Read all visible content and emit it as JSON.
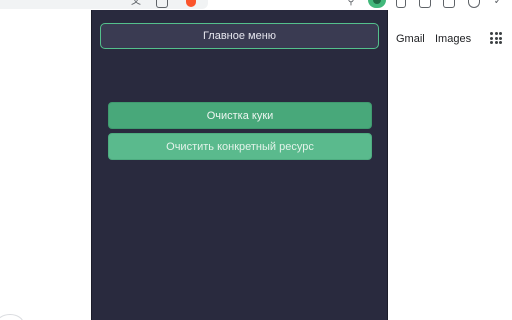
{
  "browser": {
    "toolbar_icons": [
      "translate-icon",
      "cast-icon",
      "brave-shield-icon",
      "extension-a-icon",
      "active-extension-icon",
      "puzzle-icon",
      "download-icon",
      "sidepanel-icon",
      "profile-icon",
      "bookmark-plus-icon"
    ]
  },
  "google": {
    "gmail_label": "Gmail",
    "images_label": "Images"
  },
  "popup": {
    "main_menu_label": "Главное меню",
    "clear_cookies_label": "Очистка куки",
    "clear_resource_label": "Очистить конкретный ресурс",
    "colors": {
      "background": "#292a3e",
      "accent": "#54c08c",
      "button_primary": "#48a87a",
      "button_secondary": "#5aba8d"
    }
  }
}
